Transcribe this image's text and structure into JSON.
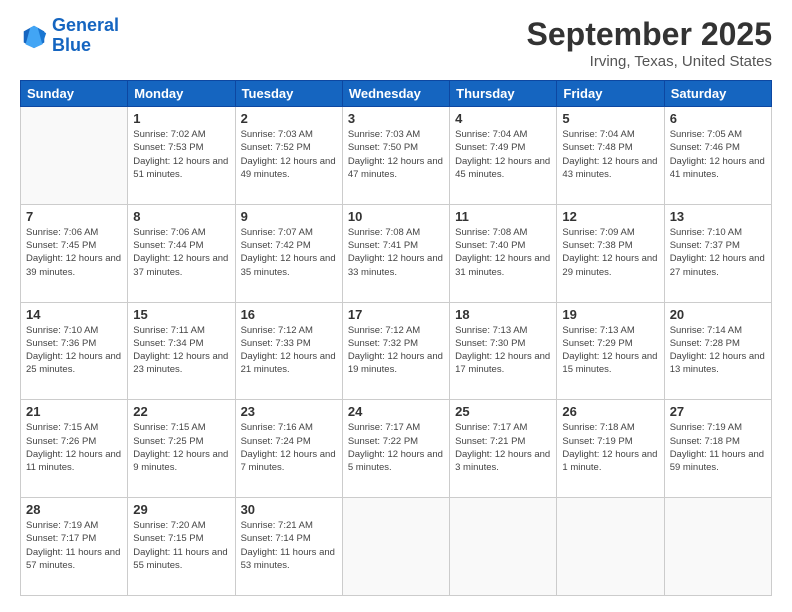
{
  "header": {
    "logo_line1": "General",
    "logo_line2": "Blue",
    "month": "September 2025",
    "location": "Irving, Texas, United States"
  },
  "days_of_week": [
    "Sunday",
    "Monday",
    "Tuesday",
    "Wednesday",
    "Thursday",
    "Friday",
    "Saturday"
  ],
  "weeks": [
    [
      {
        "num": "",
        "empty": true
      },
      {
        "num": "1",
        "sunrise": "Sunrise: 7:02 AM",
        "sunset": "Sunset: 7:53 PM",
        "daylight": "Daylight: 12 hours and 51 minutes."
      },
      {
        "num": "2",
        "sunrise": "Sunrise: 7:03 AM",
        "sunset": "Sunset: 7:52 PM",
        "daylight": "Daylight: 12 hours and 49 minutes."
      },
      {
        "num": "3",
        "sunrise": "Sunrise: 7:03 AM",
        "sunset": "Sunset: 7:50 PM",
        "daylight": "Daylight: 12 hours and 47 minutes."
      },
      {
        "num": "4",
        "sunrise": "Sunrise: 7:04 AM",
        "sunset": "Sunset: 7:49 PM",
        "daylight": "Daylight: 12 hours and 45 minutes."
      },
      {
        "num": "5",
        "sunrise": "Sunrise: 7:04 AM",
        "sunset": "Sunset: 7:48 PM",
        "daylight": "Daylight: 12 hours and 43 minutes."
      },
      {
        "num": "6",
        "sunrise": "Sunrise: 7:05 AM",
        "sunset": "Sunset: 7:46 PM",
        "daylight": "Daylight: 12 hours and 41 minutes."
      }
    ],
    [
      {
        "num": "7",
        "sunrise": "Sunrise: 7:06 AM",
        "sunset": "Sunset: 7:45 PM",
        "daylight": "Daylight: 12 hours and 39 minutes."
      },
      {
        "num": "8",
        "sunrise": "Sunrise: 7:06 AM",
        "sunset": "Sunset: 7:44 PM",
        "daylight": "Daylight: 12 hours and 37 minutes."
      },
      {
        "num": "9",
        "sunrise": "Sunrise: 7:07 AM",
        "sunset": "Sunset: 7:42 PM",
        "daylight": "Daylight: 12 hours and 35 minutes."
      },
      {
        "num": "10",
        "sunrise": "Sunrise: 7:08 AM",
        "sunset": "Sunset: 7:41 PM",
        "daylight": "Daylight: 12 hours and 33 minutes."
      },
      {
        "num": "11",
        "sunrise": "Sunrise: 7:08 AM",
        "sunset": "Sunset: 7:40 PM",
        "daylight": "Daylight: 12 hours and 31 minutes."
      },
      {
        "num": "12",
        "sunrise": "Sunrise: 7:09 AM",
        "sunset": "Sunset: 7:38 PM",
        "daylight": "Daylight: 12 hours and 29 minutes."
      },
      {
        "num": "13",
        "sunrise": "Sunrise: 7:10 AM",
        "sunset": "Sunset: 7:37 PM",
        "daylight": "Daylight: 12 hours and 27 minutes."
      }
    ],
    [
      {
        "num": "14",
        "sunrise": "Sunrise: 7:10 AM",
        "sunset": "Sunset: 7:36 PM",
        "daylight": "Daylight: 12 hours and 25 minutes."
      },
      {
        "num": "15",
        "sunrise": "Sunrise: 7:11 AM",
        "sunset": "Sunset: 7:34 PM",
        "daylight": "Daylight: 12 hours and 23 minutes."
      },
      {
        "num": "16",
        "sunrise": "Sunrise: 7:12 AM",
        "sunset": "Sunset: 7:33 PM",
        "daylight": "Daylight: 12 hours and 21 minutes."
      },
      {
        "num": "17",
        "sunrise": "Sunrise: 7:12 AM",
        "sunset": "Sunset: 7:32 PM",
        "daylight": "Daylight: 12 hours and 19 minutes."
      },
      {
        "num": "18",
        "sunrise": "Sunrise: 7:13 AM",
        "sunset": "Sunset: 7:30 PM",
        "daylight": "Daylight: 12 hours and 17 minutes."
      },
      {
        "num": "19",
        "sunrise": "Sunrise: 7:13 AM",
        "sunset": "Sunset: 7:29 PM",
        "daylight": "Daylight: 12 hours and 15 minutes."
      },
      {
        "num": "20",
        "sunrise": "Sunrise: 7:14 AM",
        "sunset": "Sunset: 7:28 PM",
        "daylight": "Daylight: 12 hours and 13 minutes."
      }
    ],
    [
      {
        "num": "21",
        "sunrise": "Sunrise: 7:15 AM",
        "sunset": "Sunset: 7:26 PM",
        "daylight": "Daylight: 12 hours and 11 minutes."
      },
      {
        "num": "22",
        "sunrise": "Sunrise: 7:15 AM",
        "sunset": "Sunset: 7:25 PM",
        "daylight": "Daylight: 12 hours and 9 minutes."
      },
      {
        "num": "23",
        "sunrise": "Sunrise: 7:16 AM",
        "sunset": "Sunset: 7:24 PM",
        "daylight": "Daylight: 12 hours and 7 minutes."
      },
      {
        "num": "24",
        "sunrise": "Sunrise: 7:17 AM",
        "sunset": "Sunset: 7:22 PM",
        "daylight": "Daylight: 12 hours and 5 minutes."
      },
      {
        "num": "25",
        "sunrise": "Sunrise: 7:17 AM",
        "sunset": "Sunset: 7:21 PM",
        "daylight": "Daylight: 12 hours and 3 minutes."
      },
      {
        "num": "26",
        "sunrise": "Sunrise: 7:18 AM",
        "sunset": "Sunset: 7:19 PM",
        "daylight": "Daylight: 12 hours and 1 minute."
      },
      {
        "num": "27",
        "sunrise": "Sunrise: 7:19 AM",
        "sunset": "Sunset: 7:18 PM",
        "daylight": "Daylight: 11 hours and 59 minutes."
      }
    ],
    [
      {
        "num": "28",
        "sunrise": "Sunrise: 7:19 AM",
        "sunset": "Sunset: 7:17 PM",
        "daylight": "Daylight: 11 hours and 57 minutes."
      },
      {
        "num": "29",
        "sunrise": "Sunrise: 7:20 AM",
        "sunset": "Sunset: 7:15 PM",
        "daylight": "Daylight: 11 hours and 55 minutes."
      },
      {
        "num": "30",
        "sunrise": "Sunrise: 7:21 AM",
        "sunset": "Sunset: 7:14 PM",
        "daylight": "Daylight: 11 hours and 53 minutes."
      },
      {
        "num": "",
        "empty": true
      },
      {
        "num": "",
        "empty": true
      },
      {
        "num": "",
        "empty": true
      },
      {
        "num": "",
        "empty": true
      }
    ]
  ]
}
